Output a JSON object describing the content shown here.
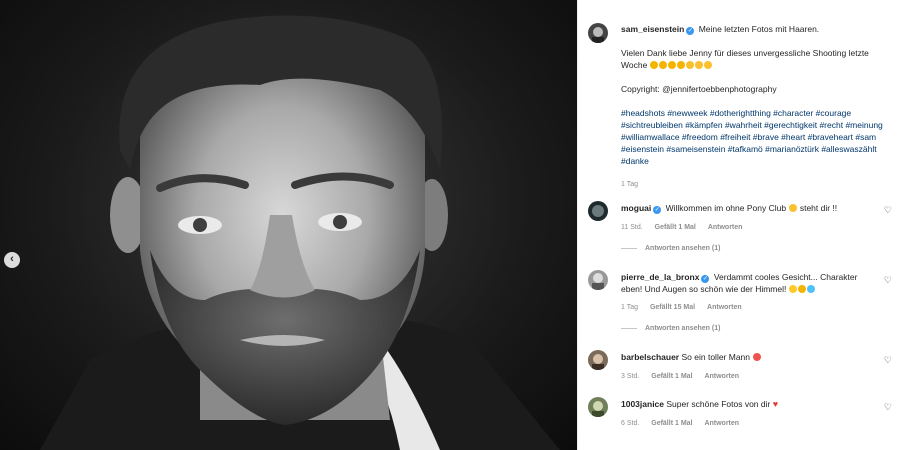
{
  "post": {
    "author": "sam_eisenstein",
    "caption_line1": "Meine letzten Fotos mit Haaren.",
    "caption_line2": "Vielen Dank liebe Jenny für dieses unvergessliche Shooting letzte Woche",
    "copyright": "Copyright: @jennifertoebbenphotography",
    "hashtags": "#headshots #newweek #dotherightthing #character #courage #sichtreubleiben #kämpfen #wahrheit #gerechtigkeit #recht #meinung #williamwallace #freedom #freiheit #brave #heart #braveheart #sam #eisenstein #sameisenstein #tafkamö #marianöztürk #alleswaszählt #danke",
    "time": "1 Tag"
  },
  "comments": [
    {
      "user": "moguai",
      "text_before": "Willkommen im ohne Pony Club",
      "text_after": "steht dir !!",
      "time": "11 Std.",
      "likes": "Gefällt 1 Mal",
      "reply": "Antworten",
      "view_replies": "Antworten ansehen (1)"
    },
    {
      "user": "pierre_de_la_bronx",
      "text": "Verdammt cooles Gesicht... Charakter eben! Und Augen so schön wie der Himmel!",
      "time": "1 Tag",
      "likes": "Gefällt 15 Mal",
      "reply": "Antworten",
      "view_replies": "Antworten ansehen (1)"
    },
    {
      "user": "barbelschauer",
      "text": "So ein toller Mann",
      "time": "3 Std.",
      "likes": "Gefällt 1 Mal",
      "reply": "Antworten"
    },
    {
      "user": "1003janice",
      "text": "Super schöne Fotos von dir",
      "time": "6 Std.",
      "likes": "Gefällt 1 Mal",
      "reply": "Antworten"
    }
  ],
  "icons": {
    "prev": "chevron-left-icon",
    "heart": "heart-outline-icon",
    "verified": "verified-badge-icon"
  },
  "colors": {
    "verified": "#3897f0",
    "hashtag": "#00376b",
    "meta": "#8e8e8e"
  }
}
